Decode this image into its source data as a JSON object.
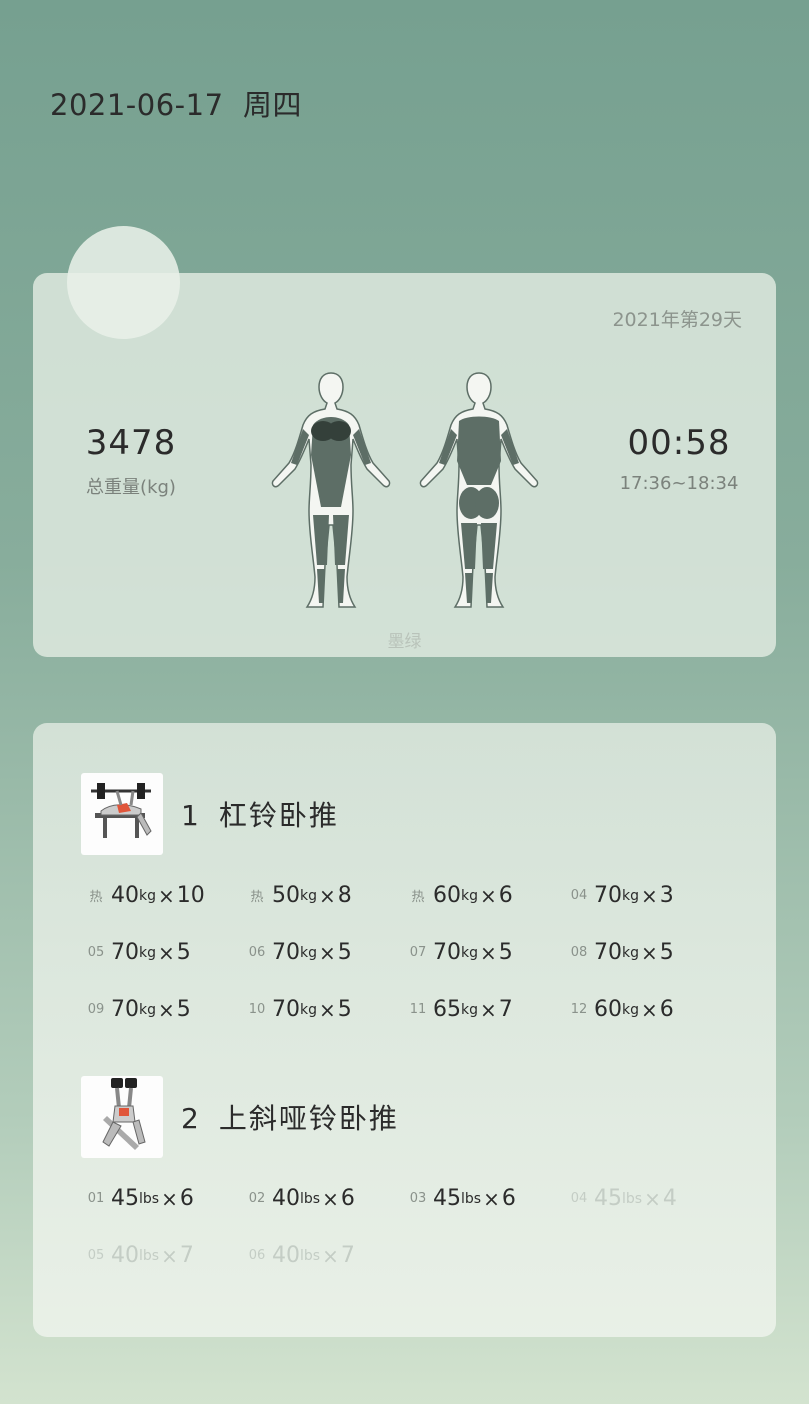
{
  "header": {
    "date": "2021-06-17",
    "weekday": "周四"
  },
  "summary": {
    "day_count": "2021年第29天",
    "total_weight": "3478",
    "total_weight_label": "总重量(kg)",
    "duration": "00:58",
    "time_range": "17:36~18:34",
    "theme_name": "墨绿"
  },
  "exercises": [
    {
      "index": "1",
      "name": "杠铃卧推",
      "thumbnail_icon": "barbell-bench-press-icon",
      "sets": [
        {
          "label": "热",
          "weight": "40",
          "unit": "kg",
          "reps": "10"
        },
        {
          "label": "热",
          "weight": "50",
          "unit": "kg",
          "reps": "8"
        },
        {
          "label": "热",
          "weight": "60",
          "unit": "kg",
          "reps": "6"
        },
        {
          "label": "04",
          "weight": "70",
          "unit": "kg",
          "reps": "3"
        },
        {
          "label": "05",
          "weight": "70",
          "unit": "kg",
          "reps": "5"
        },
        {
          "label": "06",
          "weight": "70",
          "unit": "kg",
          "reps": "5"
        },
        {
          "label": "07",
          "weight": "70",
          "unit": "kg",
          "reps": "5"
        },
        {
          "label": "08",
          "weight": "70",
          "unit": "kg",
          "reps": "5"
        },
        {
          "label": "09",
          "weight": "70",
          "unit": "kg",
          "reps": "5"
        },
        {
          "label": "10",
          "weight": "70",
          "unit": "kg",
          "reps": "5"
        },
        {
          "label": "11",
          "weight": "65",
          "unit": "kg",
          "reps": "7"
        },
        {
          "label": "12",
          "weight": "60",
          "unit": "kg",
          "reps": "6"
        }
      ]
    },
    {
      "index": "2",
      "name": "上斜哑铃卧推",
      "thumbnail_icon": "incline-dumbbell-press-icon",
      "sets": [
        {
          "label": "01",
          "weight": "45",
          "unit": "lbs",
          "reps": "6"
        },
        {
          "label": "02",
          "weight": "40",
          "unit": "lbs",
          "reps": "6"
        },
        {
          "label": "03",
          "weight": "45",
          "unit": "lbs",
          "reps": "6"
        },
        {
          "label": "04",
          "weight": "45",
          "unit": "lbs",
          "reps": "4"
        },
        {
          "label": "05",
          "weight": "40",
          "unit": "lbs",
          "reps": "7"
        },
        {
          "label": "06",
          "weight": "40",
          "unit": "lbs",
          "reps": "7"
        }
      ]
    }
  ],
  "multiply_sign": "×",
  "colors": {
    "accent": "#2b2b2b",
    "muscle": "#5d6e66",
    "highlight": "#34403a"
  }
}
